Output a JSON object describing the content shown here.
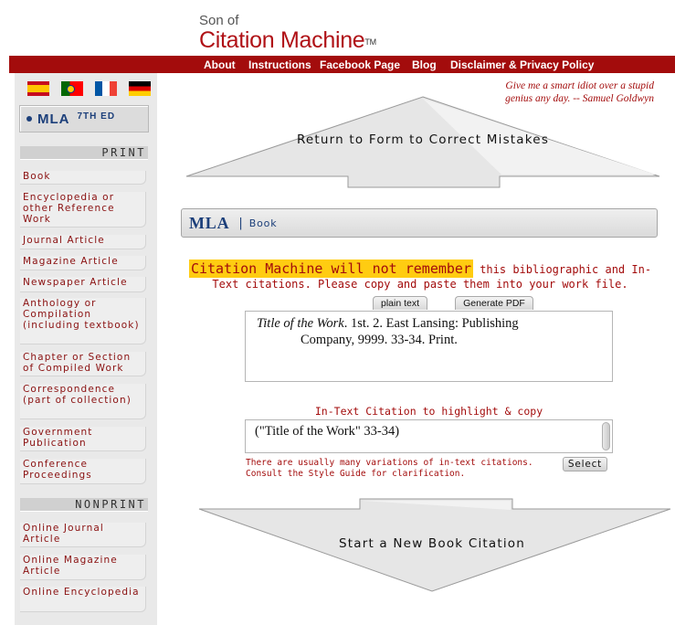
{
  "logo": {
    "son_of": "Son of",
    "name": "Citation Machine",
    "tm": "TM"
  },
  "nav": {
    "items": [
      "About",
      "Instructions",
      "Facebook Page",
      "Blog",
      "Disclaimer & Privacy Policy"
    ]
  },
  "sidebar": {
    "flags": [
      "spanish-flag",
      "portuguese-flag",
      "french-flag",
      "german-flag"
    ],
    "style": {
      "name": "MLA",
      "edition": "7TH ED"
    },
    "print_heading": "PRINT",
    "print_items": [
      "Book",
      "Encyclopedia or other Reference Work",
      "Journal Article",
      "Magazine Article",
      "Newspaper Article",
      "Anthology or Compilation (including textbook)",
      "Chapter or Section of Compiled Work",
      "Correspondence (part of collection)",
      "Government Publication",
      "Conference Proceedings"
    ],
    "nonprint_heading": "NONPRINT",
    "nonprint_items": [
      "Online Journal Article",
      "Online Magazine Article",
      "Online Encyclopedia"
    ]
  },
  "quote": {
    "line1": "Give me a smart idiot over a stupid",
    "line2": "genius any day. -- Samuel Goldwyn"
  },
  "return_button": "Return to Form to Correct Mistakes",
  "style_header": {
    "style": "MLA",
    "separator": "|",
    "type": "Book"
  },
  "warning": {
    "highlight": "Citation Machine will not remember",
    "rest": " this bibliographic and In-Text citations. Please copy and paste them into your work file."
  },
  "tabs": {
    "plain_text": "plain text",
    "generate_pdf": "Generate PDF"
  },
  "citation": {
    "title": "Title of the Work",
    "rest_line1": ". 1st. 2. East Lansing: Publishing",
    "line2": "Company, 9999. 33-34. Print."
  },
  "in_text": {
    "label": "In-Text Citation to highlight & copy",
    "value": "(\"Title of the Work\" 33-34)",
    "note_line1": "There are usually many variations of in-text citations.",
    "note_line2": "Consult the Style Guide for clarification.",
    "select_label": "Select"
  },
  "new_citation_button": "Start a New Book Citation",
  "colors": {
    "brand_red": "#a30c0c",
    "navy": "#1c3f7a",
    "highlight": "#ffcc11",
    "sidebar_bg": "#e9e9e9"
  }
}
